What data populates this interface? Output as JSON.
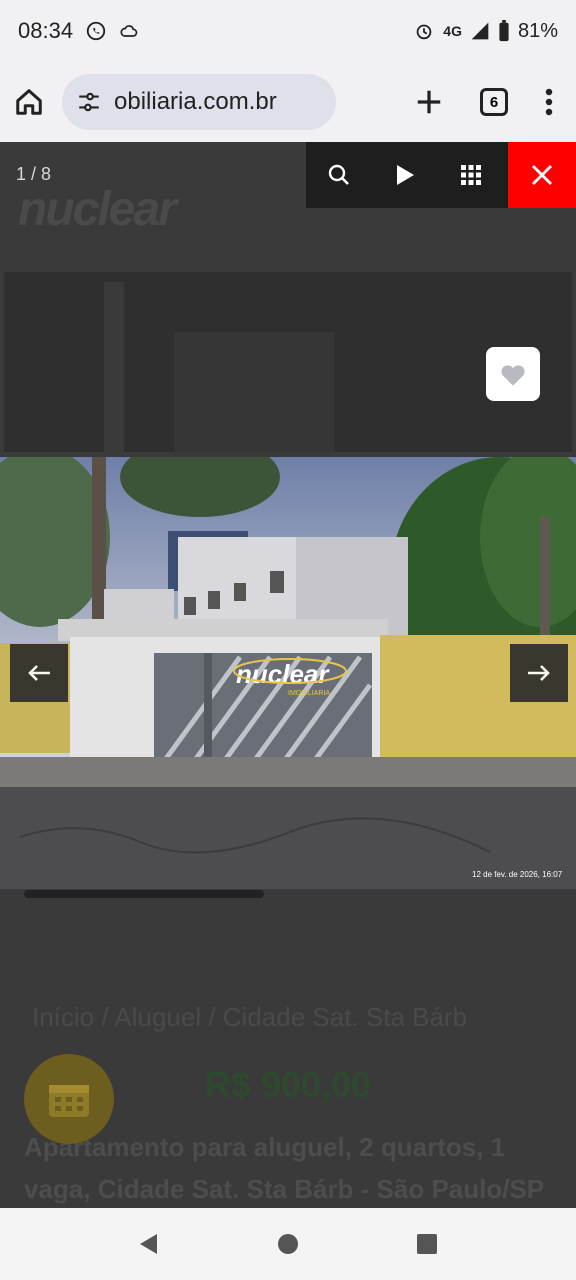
{
  "status": {
    "time": "08:34",
    "network": "4G",
    "battery": "81%",
    "icons": [
      "whatsapp-icon",
      "cloud-icon",
      "alarm-icon",
      "signal-icon",
      "battery-icon"
    ]
  },
  "browser": {
    "url": "obiliaria.com.br",
    "tab_count": "6",
    "icons": [
      "home-icon",
      "site-settings-icon",
      "new-tab-icon",
      "tabs-icon",
      "menu-icon"
    ]
  },
  "lightbox": {
    "counter": "1 / 8",
    "timestamp": "12 de fev. de 2026, 16:07",
    "watermark": "nuclear",
    "watermark_sub": "IMOBILIARIA",
    "close_color": "#ff0000"
  },
  "page": {
    "logo": "nuclear",
    "breadcrumb": "Início  /  Aluguel  /  Cidade Sat. Sta Bárb",
    "price": "R$ 900,00",
    "title": "Apartamento para aluguel, 2 quartos, 1 vaga, Cidade Sat. Sta Bárb - São Paulo/SP",
    "title_visible": "mento para aluguel, 2 quartos,\n      ga, Cidade Sat. Sta Bárb - São\nPaulo/SP"
  },
  "nav": {
    "icons": [
      "back-icon",
      "home-circle-icon",
      "recents-icon"
    ]
  }
}
